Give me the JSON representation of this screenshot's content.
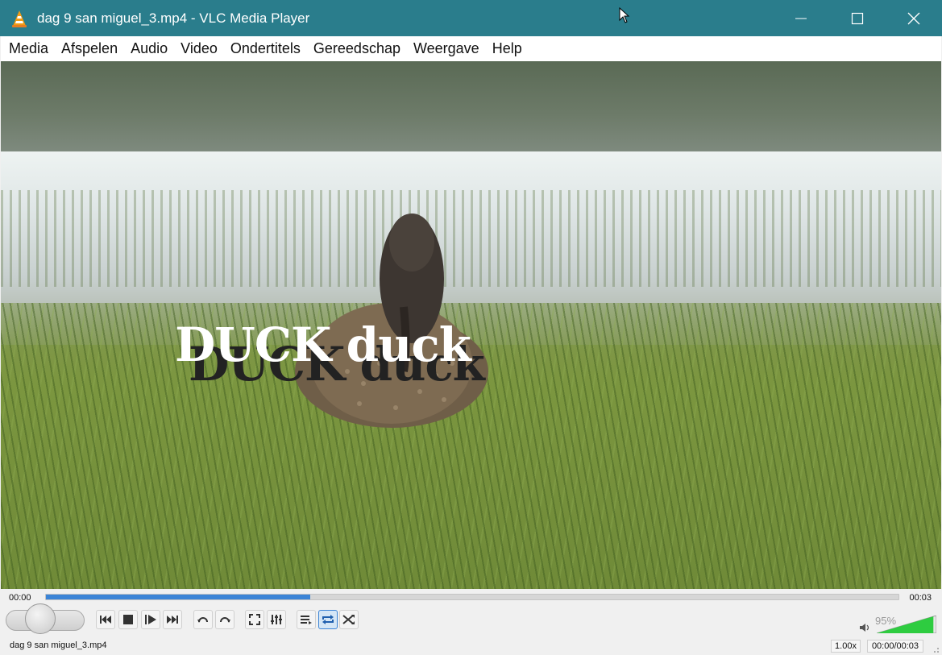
{
  "window": {
    "title": "dag 9 san miguel_3.mp4 - VLC Media Player",
    "app_icon": "vlc-cone-icon",
    "controls": [
      "minimize-icon",
      "maximize-icon",
      "close-icon"
    ],
    "titlebar_color": "#2a7d8c"
  },
  "menu": {
    "items": [
      "Media",
      "Afspelen",
      "Audio",
      "Video",
      "Ondertitels",
      "Gereedschap",
      "Weergave",
      "Help"
    ]
  },
  "video": {
    "subtitle": "DUCK duck"
  },
  "playback": {
    "elapsed": "00:00",
    "total": "00:03",
    "progress_fraction": 0.31,
    "progress_color": "#3b84d6"
  },
  "buttons": [
    {
      "name": "previous-button",
      "icon": "skip-previous-icon"
    },
    {
      "name": "stop-button",
      "icon": "stop-icon"
    },
    {
      "name": "next-frame-button",
      "icon": "frame-step-icon"
    },
    {
      "name": "next-button",
      "icon": "skip-next-icon"
    },
    {
      "name": "jump-back-button",
      "icon": "rewind-icon"
    },
    {
      "name": "jump-forward-button",
      "icon": "forward-icon"
    },
    {
      "name": "fullscreen-button",
      "icon": "fullscreen-icon"
    },
    {
      "name": "extended-settings-button",
      "icon": "equalizer-icon"
    },
    {
      "name": "playlist-button",
      "icon": "playlist-icon"
    },
    {
      "name": "loop-button",
      "icon": "loop-icon",
      "active": true
    },
    {
      "name": "shuffle-button",
      "icon": "shuffle-icon"
    }
  ],
  "volume": {
    "label": "95%",
    "level_fraction": 0.95,
    "color": "#2ecc40"
  },
  "status": {
    "filename": "dag 9 san miguel_3.mp4",
    "speed": "1.00x",
    "time": "00:00/00:03"
  }
}
